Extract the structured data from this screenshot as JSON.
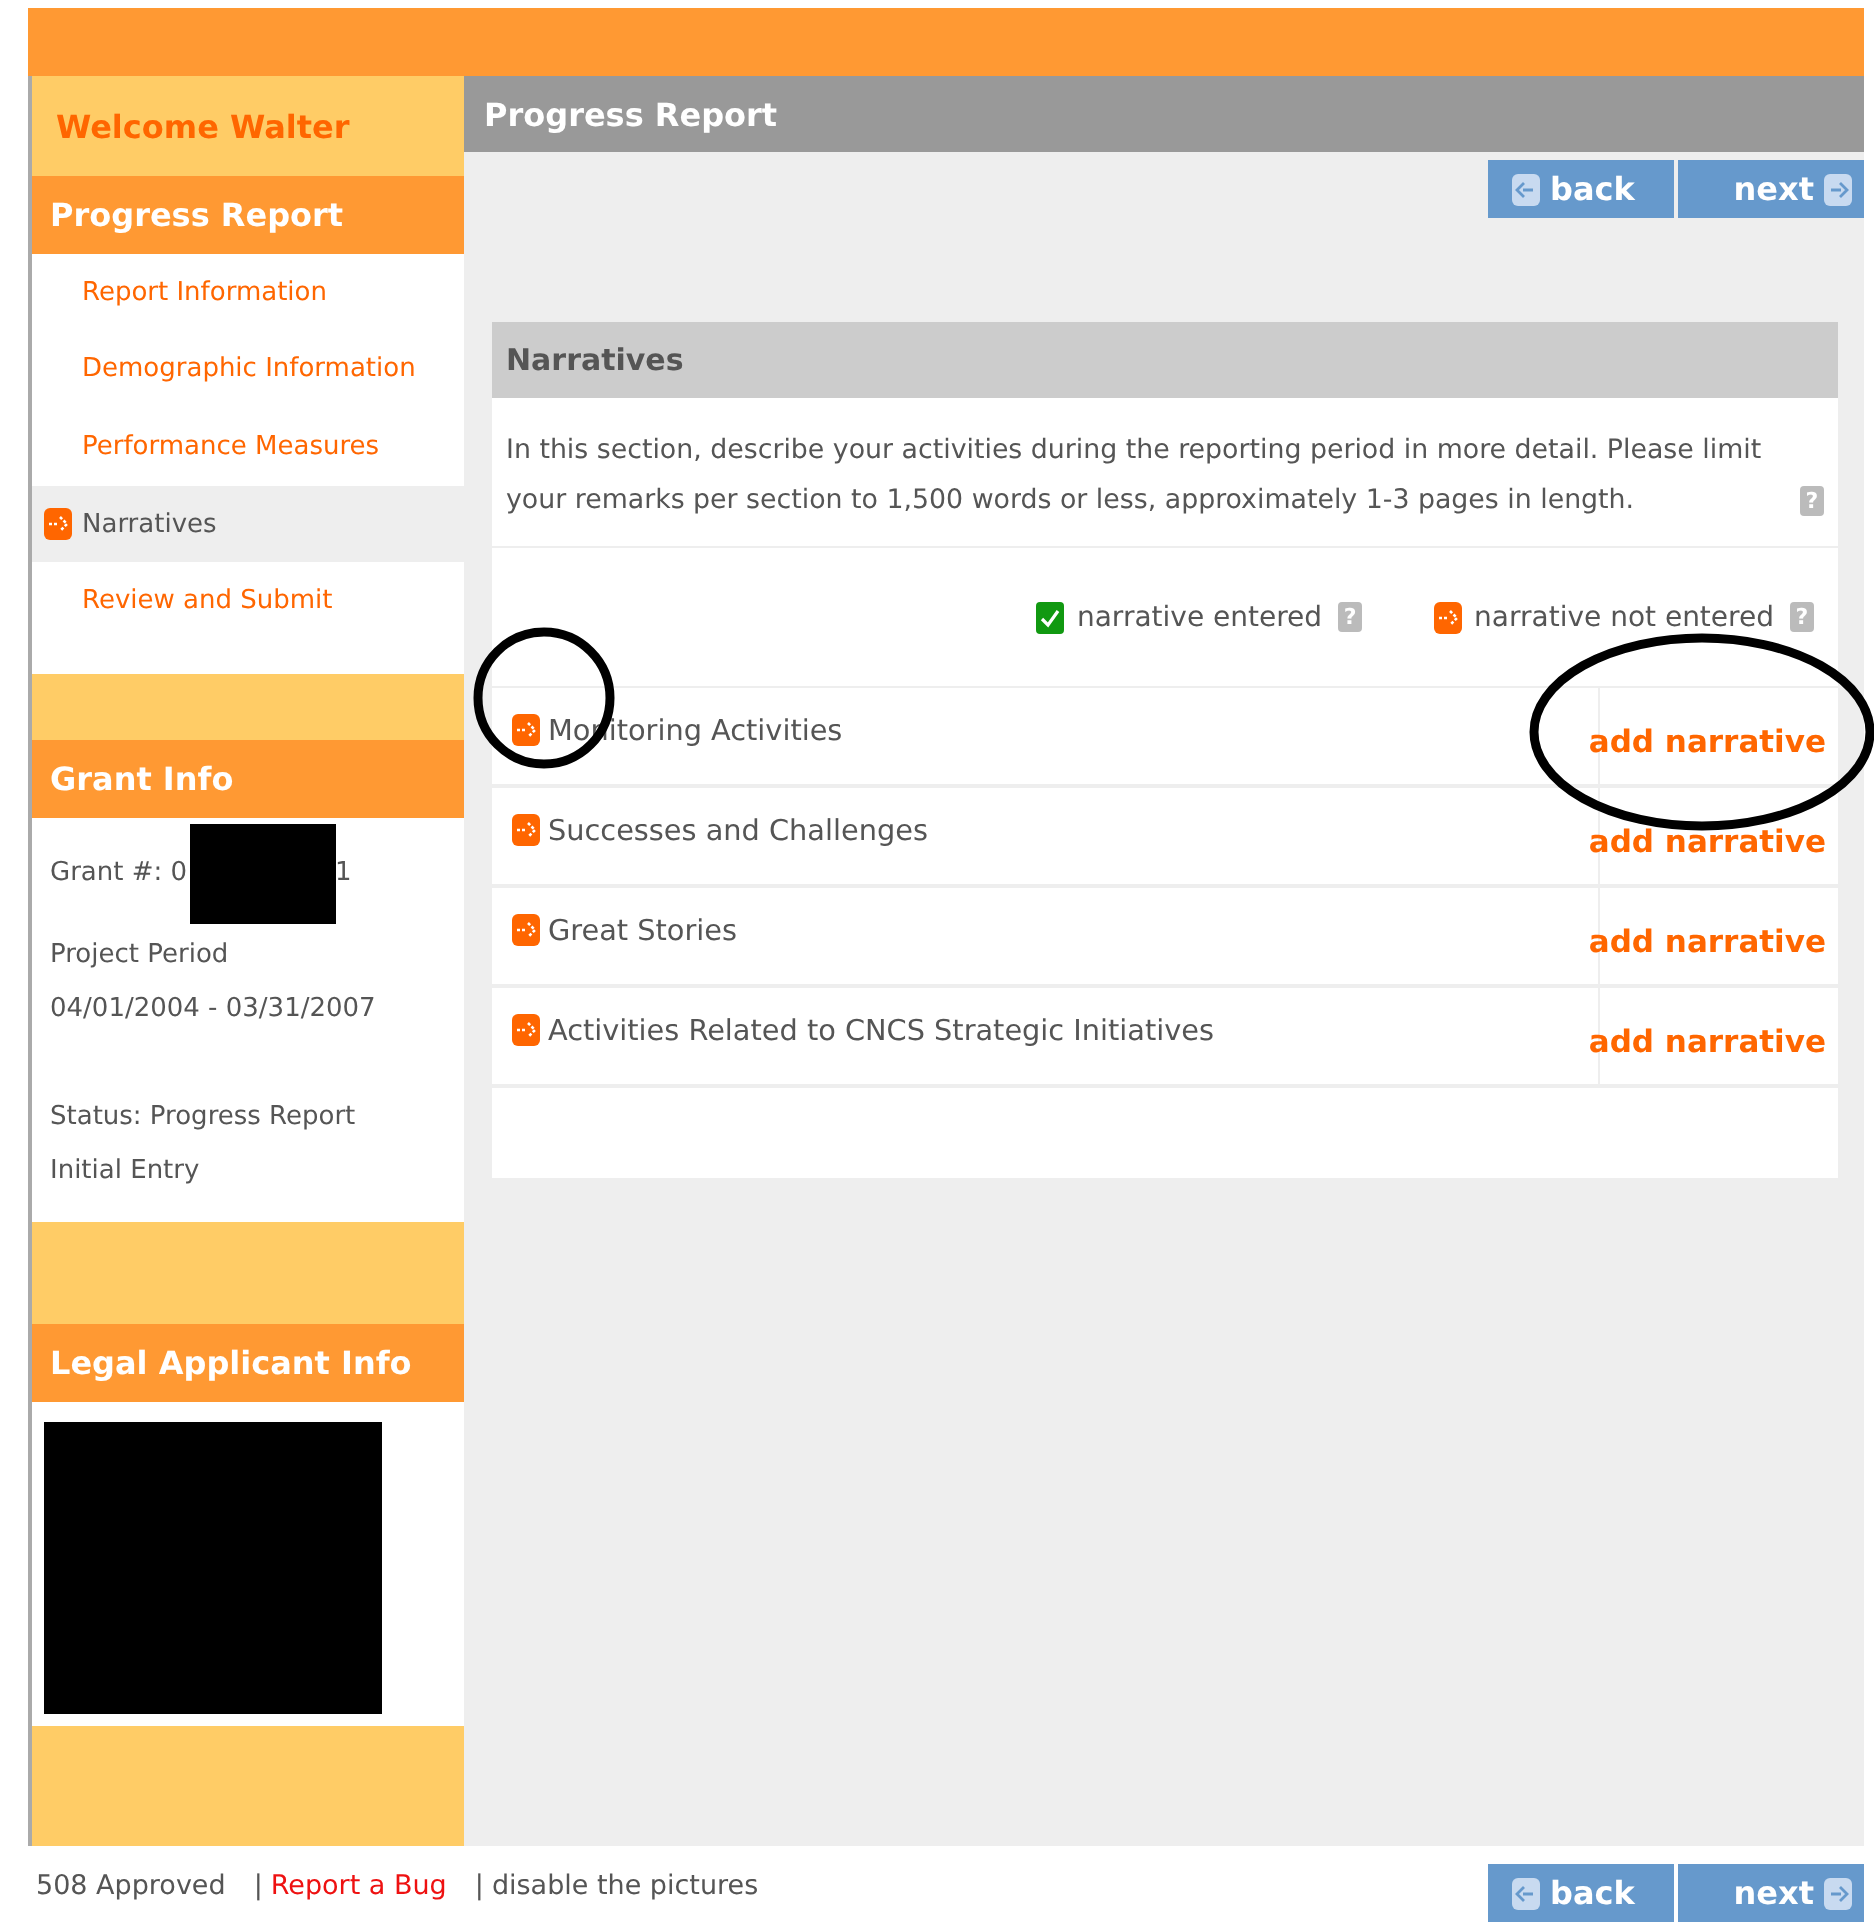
{
  "sidebar": {
    "welcome": "Welcome Walter",
    "progress_heading": "Progress Report",
    "nav_items": [
      {
        "label": "Report Information",
        "selected": false
      },
      {
        "label": "Demographic Information",
        "selected": false
      },
      {
        "label": "Performance Measures",
        "selected": false
      },
      {
        "label": "Narratives",
        "selected": true
      },
      {
        "label": "Review and Submit",
        "selected": false
      }
    ],
    "grant_info": {
      "heading": "Grant Info",
      "grant_number_start": "Grant #: 0",
      "grant_number_end": "1",
      "project_period_label": "Project Period",
      "project_period": "04/01/2004 - 03/31/2007",
      "status": "Status: Progress Report Initial Entry"
    },
    "legal_applicant": {
      "heading": "Legal Applicant Info"
    }
  },
  "main": {
    "title": "Progress Report",
    "nav_buttons": [
      {
        "label": "back"
      },
      {
        "label": "next"
      }
    ],
    "panel": {
      "title": "Narratives",
      "description": "In this section, describe your activities during the reporting period in more detail. Please limit your remarks per section to 1,500 words or less, approximately 1-3 pages in length.",
      "description_help": "?",
      "legend": [
        {
          "kind": "entered",
          "label": "narrative entered",
          "help": "?"
        },
        {
          "kind": "not_entered",
          "label": "narrative not entered",
          "help": "?"
        }
      ],
      "rows": [
        {
          "title": "Monitoring Activities",
          "entered": false,
          "action": "add narrative"
        },
        {
          "title": "Successes and Challenges",
          "entered": false,
          "action": "add narrative"
        },
        {
          "title": "Great Stories",
          "entered": false,
          "action": "add narrative"
        },
        {
          "title": "Activities Related to CNCS Strategic Initiatives",
          "entered": false,
          "action": "add narrative"
        }
      ]
    }
  },
  "footer": {
    "links": [
      {
        "kind": "text",
        "text": "508 Approved"
      },
      {
        "kind": "separator",
        "text": "|"
      },
      {
        "kind": "link",
        "text": "Report a Bug"
      },
      {
        "kind": "separator",
        "text": "|"
      },
      {
        "kind": "action",
        "text": "disable the pictures"
      }
    ],
    "nav_buttons": [
      {
        "label": "back"
      },
      {
        "label": "next"
      }
    ]
  }
}
